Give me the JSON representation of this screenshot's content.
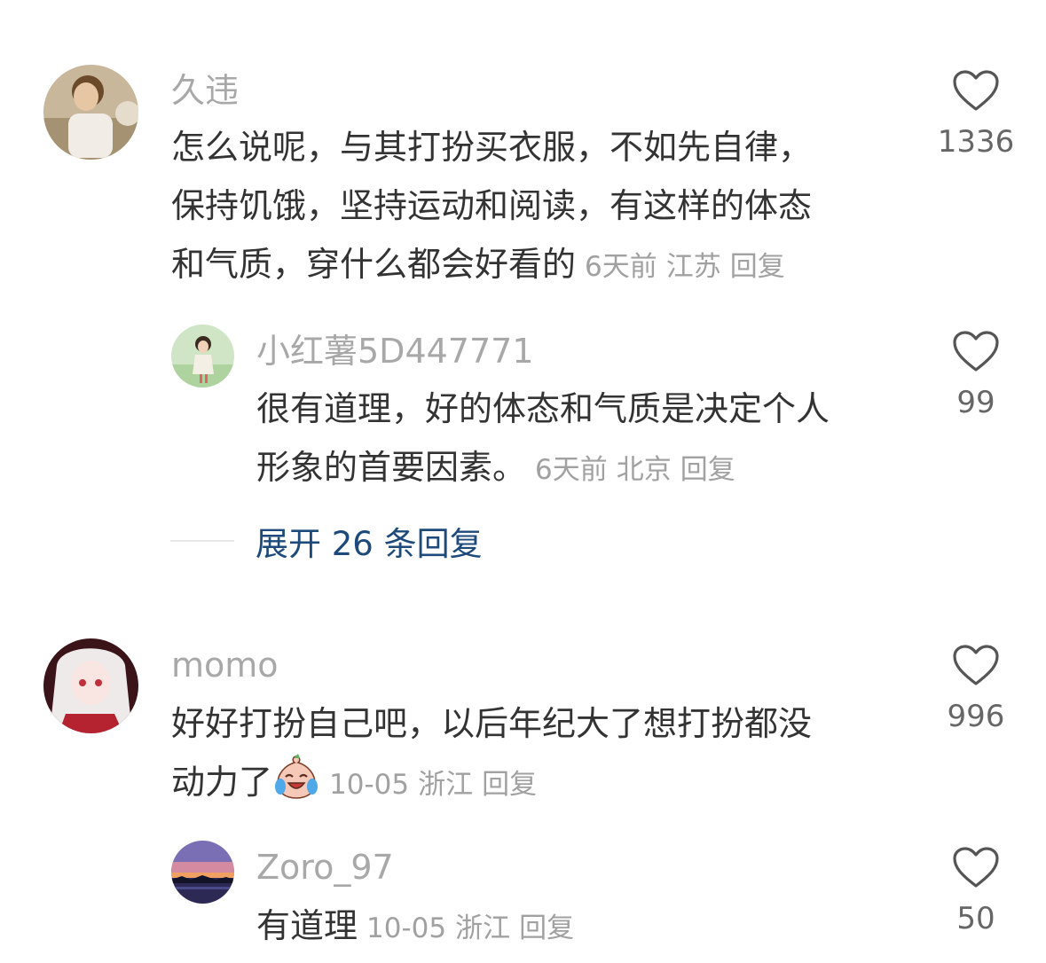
{
  "comments": [
    {
      "user": "久违",
      "avatar_icon": "child-photo-avatar",
      "lines": [
        "怎么说呢，与其打扮买衣服，不如先自律，",
        "保持饥饿，坚持运动和阅读，有这样的体态",
        "和气质，穿什么都会好看的"
      ],
      "time": "6天前",
      "location": "江苏",
      "reply_label": "回复",
      "likes": "1336",
      "replies": [
        {
          "user": "小红薯5D447771",
          "avatar_icon": "anime-girl-green-avatar",
          "lines": [
            "很有道理，好的体态和气质是决定个人",
            "形象的首要因素。"
          ],
          "time": "6天前",
          "location": "北京",
          "reply_label": "回复",
          "likes": "99"
        }
      ],
      "expand_label": "展开 26 条回复"
    },
    {
      "user": "momo",
      "avatar_icon": "anime-white-hair-avatar",
      "lines": [
        "好好打扮自己吧，以后年纪大了想打扮都没",
        "动力了"
      ],
      "emoji": "laugh-cry-emoji",
      "time": "10-05",
      "location": "浙江",
      "reply_label": "回复",
      "likes": "996",
      "replies": [
        {
          "user": "Zoro_97",
          "avatar_icon": "sunset-landscape-avatar",
          "lines": [
            "有道理"
          ],
          "time": "10-05",
          "location": "浙江",
          "reply_label": "回复",
          "likes": "50"
        }
      ]
    }
  ],
  "colors": {
    "username": "#a8a8a8",
    "body": "#333333",
    "meta": "#a1a1a1",
    "expand": "#1d4a7a",
    "like_count": "#666666"
  }
}
